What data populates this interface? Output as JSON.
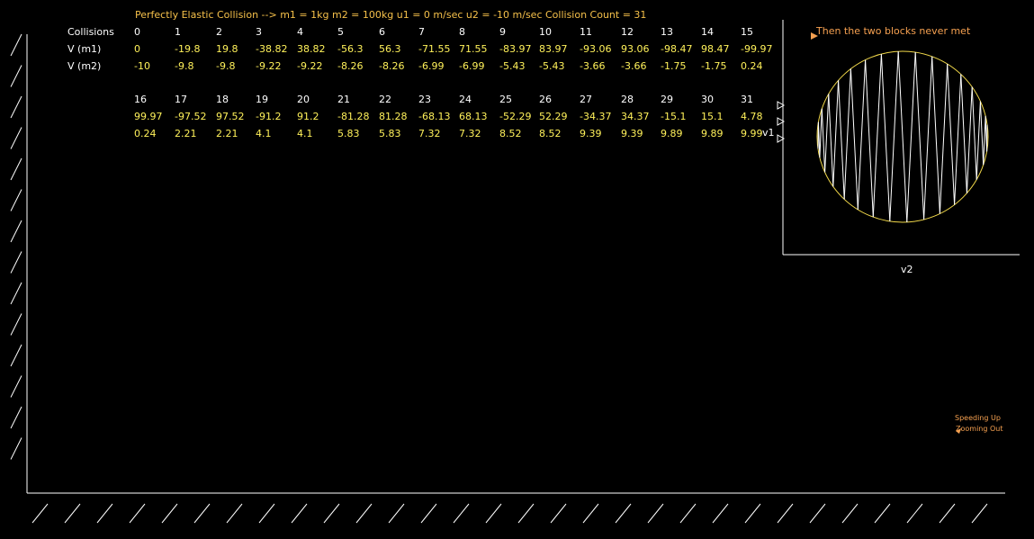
{
  "title": "Perfectly Elastic Collision --> m1 = 1kg  m2 = 100kg  u1 = 0 m/sec  u2 = -10 m/sec   Collision Count = 31",
  "row_labels": {
    "collisions": "Collisions",
    "v_m1": "V (m1)",
    "v_m2": "V (m2)"
  },
  "table_part1": {
    "collisions": [
      "0",
      "1",
      "2",
      "3",
      "4",
      "5",
      "6",
      "7",
      "8",
      "9",
      "10",
      "11",
      "12",
      "13",
      "14",
      "15"
    ],
    "v_m1": [
      "0",
      "-19.8",
      "19.8",
      "-38.82",
      "38.82",
      "-56.3",
      "56.3",
      "-71.55",
      "71.55",
      "-83.97",
      "83.97",
      "-93.06",
      "93.06",
      "-98.47",
      "98.47",
      "-99.97"
    ],
    "v_m2": [
      "-10",
      "-9.8",
      "-9.8",
      "-9.22",
      "-9.22",
      "-8.26",
      "-8.26",
      "-6.99",
      "-6.99",
      "-5.43",
      "-5.43",
      "-3.66",
      "-3.66",
      "-1.75",
      "-1.75",
      "0.24"
    ]
  },
  "table_part2": {
    "collisions": [
      "16",
      "17",
      "18",
      "19",
      "20",
      "21",
      "22",
      "23",
      "24",
      "25",
      "26",
      "27",
      "28",
      "29",
      "30",
      "31"
    ],
    "v_m1": [
      "99.97",
      "-97.52",
      "97.52",
      "-91.2",
      "91.2",
      "-81.28",
      "81.28",
      "-68.13",
      "68.13",
      "-52.29",
      "52.29",
      "-34.37",
      "34.37",
      "-15.1",
      "15.1",
      "4.78"
    ],
    "v_m2": [
      "0.24",
      "2.21",
      "2.21",
      "4.1",
      "4.1",
      "5.83",
      "5.83",
      "7.32",
      "7.32",
      "8.52",
      "8.52",
      "9.39",
      "9.39",
      "9.89",
      "9.89",
      "9.99"
    ]
  },
  "phase_plot": {
    "annotation": "Then the two blocks never met",
    "x_axis_label": "v2",
    "y_axis_label": "v1"
  },
  "notes": {
    "speeding_up": "Speeding Up",
    "zooming_out": "Zooming Out"
  },
  "colors": {
    "title": "#f5c04a",
    "values": "#fff15a",
    "circle": "#f2d94a",
    "annotation": "#f5a050"
  }
}
